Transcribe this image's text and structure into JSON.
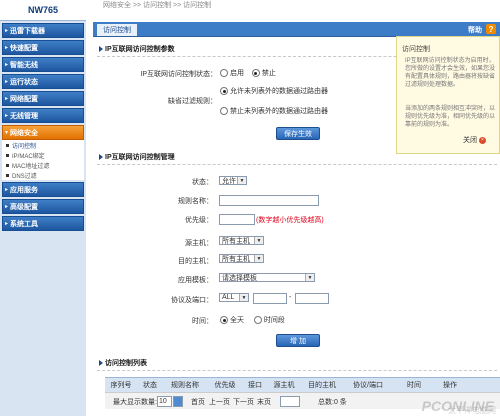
{
  "sidebar": {
    "brand": "NW765",
    "groups": [
      {
        "label": "迅雷下载器"
      },
      {
        "label": "快速配置"
      },
      {
        "label": "智能无线"
      },
      {
        "label": "运行状态"
      },
      {
        "label": "网络配置"
      },
      {
        "label": "无线管理"
      },
      {
        "label": "网络安全"
      },
      {
        "label": "应用服务"
      },
      {
        "label": "高级配置"
      },
      {
        "label": "系统工具"
      }
    ],
    "security_sub": [
      "访问控制",
      "IP/MAC绑定",
      "MAC地址过滤",
      "DNS过滤"
    ]
  },
  "breadcrumb": "网络安全 >> 访问控制 >> 访问控制",
  "tab_label": "访问控制",
  "help_label": "帮助",
  "help_icon": "?",
  "section1": {
    "title": "IP互联网访问控制参数",
    "status_label": "IP互联网访问控制状态：",
    "status_enable": "启用",
    "status_disable": "禁止",
    "default_rule_label": "缺省过滤规则：",
    "rule_allow": "允许未列表外的数据通过路由器",
    "rule_deny": "禁止未列表外的数据通过路由器",
    "save_button": "保存生效"
  },
  "section2": {
    "title": "IP互联网访问控制管理",
    "state_label": "状态：",
    "state_value": "允许",
    "rule_name_label": "规则名称：",
    "priority_label": "优先级：",
    "priority_hint": "(数字越小优先级越高)",
    "src_host_label": "源主机：",
    "src_host_value": "所有主机",
    "dst_host_label": "目的主机：",
    "dst_host_value": "所有主机",
    "app_template_label": "应用模板：",
    "app_template_value": "请选择模板",
    "proto_port_label": "协议及端口：",
    "proto_value": "ALL",
    "port_sep": "-",
    "time_label": "时间：",
    "time_all": "全天",
    "time_period": "时间段",
    "add_button": "增 加"
  },
  "section3": {
    "title": "访问控制列表",
    "columns": [
      "序列号",
      "状态",
      "规则名称",
      "优先级",
      "接口",
      "源主机",
      "目的主机",
      "协议/端口",
      "时间",
      "操作"
    ],
    "max_display_label": "最大显示数量:",
    "max_display_value": "10",
    "first_page": "首页",
    "prev_page": "上一页",
    "next_page": "下一页",
    "last_page": "末页",
    "total_label": "总数:0 条"
  },
  "popup": {
    "title": "访问控制",
    "text1": "IP互联网访问控制状态为启用时，您所做的设置才会生效，如果您没有配置具体规则，路由器将按缺省过滤规则处理数据。",
    "text2": "当添加的两条规则相互冲突时，以规则优先级为准，相同优先级的以靠前的规则为准。",
    "close_label": "关闭"
  },
  "watermark": "PCONLINE",
  "watermark_sub": "太平洋电脑网",
  "colors": {
    "sidebar_group": "#2a64ad",
    "active_group": "#f08b00",
    "tab_bar": "#3d7cc7",
    "popup_bg": "#fffbe3",
    "priority_hint": "#e0001b"
  }
}
